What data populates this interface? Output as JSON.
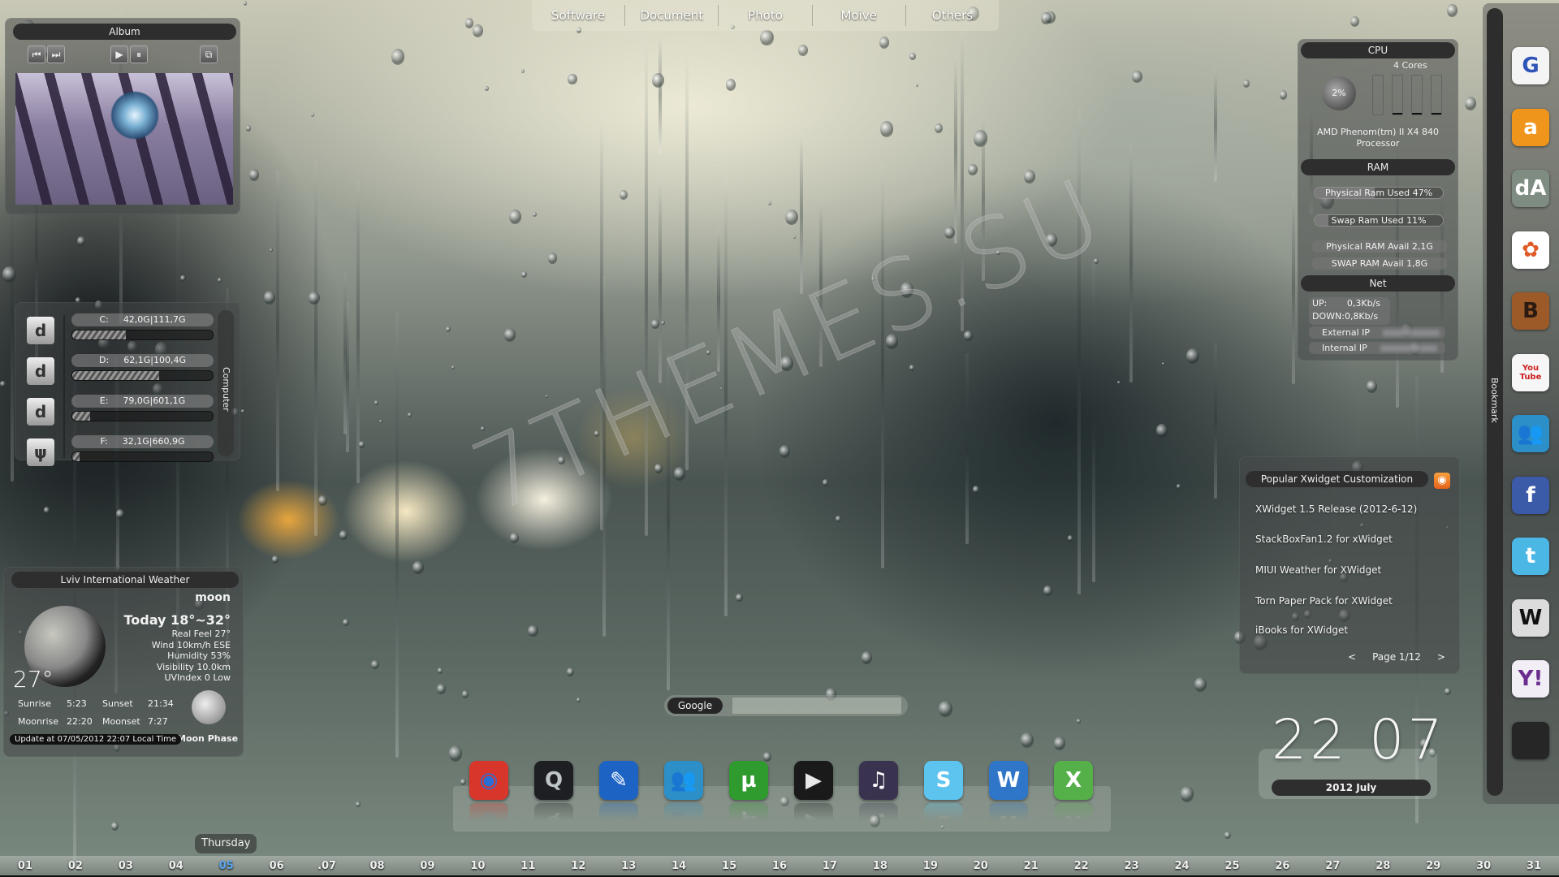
{
  "watermark": "7THEMES.SU",
  "top_categories": [
    "Software",
    "Document",
    "Photo",
    "Moive",
    "Others"
  ],
  "album": {
    "title": "Album",
    "controls": {
      "prev": "⏮",
      "next": "⏭",
      "play": "▶",
      "pause": "⏸",
      "window": "⧉"
    },
    "controls_icons": [
      "previous-icon",
      "next-icon",
      "play-icon",
      "pause-icon",
      "window-icon"
    ]
  },
  "computer": {
    "label": "Computer",
    "drives": [
      {
        "letter": "C:",
        "used": "42,0G",
        "total": "111,7G",
        "usage_fraction": 0.38,
        "type": "hard-disk"
      },
      {
        "letter": "D:",
        "used": "62,1G",
        "total": "100,4G",
        "usage_fraction": 0.62,
        "type": "hard-disk"
      },
      {
        "letter": "E:",
        "used": "79,0G",
        "total": "601,1G",
        "usage_fraction": 0.13,
        "type": "hard-disk"
      },
      {
        "letter": "F:",
        "used": "32,1G",
        "total": "660,9G",
        "usage_fraction": 0.05,
        "type": "usb"
      }
    ]
  },
  "weather": {
    "title": "Lviv International Weather",
    "condition": "moon",
    "temperature": "27°",
    "today": "Today 18°~32°",
    "details": [
      "Real Feel 27°",
      "Wind 10km/h ESE",
      "Humidity 53%",
      "Visibility 10.0km",
      "UVIndex 0 Low"
    ],
    "sunrise_label": "Sunrise",
    "sunrise": "5:23",
    "sunset_label": "Sunset",
    "sunset": "21:34",
    "moonrise_label": "Moonrise",
    "moonrise": "22:20",
    "moonset_label": "Moonset",
    "moonset": "7:27",
    "moon_phase_label": "Moon Phase",
    "update": "Update at 07/05/2012 22:07 Local Time"
  },
  "sysmon": {
    "cpu_title": "CPU",
    "cpu_usage": "2%",
    "cores_label": "4  Cores",
    "core_usage_fractions": [
      0.0,
      0.02,
      0.02,
      0.02
    ],
    "cpu_name": "AMD Phenom(tm) II X4 840 Processor",
    "ram_title": "RAM",
    "physical_ram_used_label": "Physical Ram Used",
    "physical_ram_used": "47%",
    "physical_ram_fraction": 0.47,
    "swap_ram_used_label": "Swap Ram Used",
    "swap_ram_used": "11%",
    "swap_ram_fraction": 0.11,
    "physical_ram_avail": "Physical RAM Avail 2,1G",
    "swap_ram_avail": "SWAP RAM Avail    1,8G",
    "net_title": "Net",
    "up": "UP:       0,3Kb/s",
    "down": "DOWN:0,8Kb/s",
    "external_ip_label": "External IP",
    "internal_ip_label": "Internal IP"
  },
  "rss": {
    "title": "Popular Xwidget Customization",
    "items": [
      "XWidget 1.5  Release (2012-6-12)",
      "StackBoxFan1.2 for xWidget",
      "MIUI Weather for XWidget",
      "Torn Paper Pack for XWidget",
      "iBooks for XWidget"
    ],
    "prev": "<",
    "page": "Page 1/12",
    "next": ">"
  },
  "clock": {
    "time": "22 07",
    "date": "2012  July"
  },
  "search": {
    "engine": "Google",
    "value": "",
    "placeholder": ""
  },
  "dock": [
    {
      "name": "chrome",
      "glyph": "◉",
      "bg": "#d8352b",
      "fg": "#2a6fd6"
    },
    {
      "name": "quicktime",
      "glyph": "Q",
      "bg": "#1e1f22",
      "fg": "#bfc4c9"
    },
    {
      "name": "pages-writer",
      "glyph": "✎",
      "bg": "#1d63c4",
      "fg": "#ffffff"
    },
    {
      "name": "messenger",
      "glyph": "👥",
      "bg": "#2c8fc7",
      "fg": "#ffffff"
    },
    {
      "name": "utorrent",
      "glyph": "µ",
      "bg": "#2f9a2d",
      "fg": "#ffffff"
    },
    {
      "name": "media-player",
      "glyph": "▶",
      "bg": "#1a1a1a",
      "fg": "#e8e8e8"
    },
    {
      "name": "itunes",
      "glyph": "♫",
      "bg": "#3a3350",
      "fg": "#ffffff"
    },
    {
      "name": "skype",
      "glyph": "S",
      "bg": "#5cc4ee",
      "fg": "#ffffff"
    },
    {
      "name": "word",
      "glyph": "W",
      "bg": "#2f75c8",
      "fg": "#ffffff"
    },
    {
      "name": "excel",
      "glyph": "X",
      "bg": "#55b04a",
      "fg": "#ffffff"
    }
  ],
  "calendar": {
    "weekday": "Thursday",
    "today": "05",
    "days": [
      "01",
      "02",
      "03",
      "04",
      "05",
      "06",
      ".07",
      "08",
      "09",
      "10",
      "11",
      "12",
      "13",
      "14",
      "15",
      "16",
      "17",
      "18",
      "19",
      "20",
      "21",
      "22",
      "23",
      "24",
      "25",
      "26",
      "27",
      "28",
      "29",
      "30",
      "31"
    ]
  },
  "bookmarks": {
    "label": "Bookmark",
    "items": [
      {
        "name": "google",
        "glyph": "G",
        "bg": "#f4f4f4",
        "fg": "#2e54b8"
      },
      {
        "name": "amazon",
        "glyph": "a",
        "bg": "#f0951c",
        "fg": "#ffffff"
      },
      {
        "name": "deviantart",
        "glyph": "dA",
        "bg": "#7f8c82",
        "fg": "#ffffff"
      },
      {
        "name": "live",
        "glyph": "✿",
        "bg": "#ffffff",
        "fg": "#e05a28"
      },
      {
        "name": "blogger",
        "glyph": "B",
        "bg": "#9b5a28",
        "fg": "#2a1a10"
      },
      {
        "name": "youtube",
        "glyph": "You Tube",
        "bg": "#f6f6f6",
        "fg": "#cc2020"
      },
      {
        "name": "messenger",
        "glyph": "👥",
        "bg": "#2c8fc7",
        "fg": "#ffffff"
      },
      {
        "name": "facebook",
        "glyph": "f",
        "bg": "#3b5aa8",
        "fg": "#ffffff"
      },
      {
        "name": "twitter",
        "glyph": "t",
        "bg": "#4bb7e5",
        "fg": "#ffffff"
      },
      {
        "name": "wikipedia",
        "glyph": "W",
        "bg": "#dcdcdc",
        "fg": "#111111"
      },
      {
        "name": "yahoo",
        "glyph": "Y!",
        "bg": "#f1eef6",
        "fg": "#6b2c8f"
      },
      {
        "name": "apple",
        "glyph": "",
        "bg": "#262626",
        "fg": "#e8e8e8"
      }
    ]
  }
}
